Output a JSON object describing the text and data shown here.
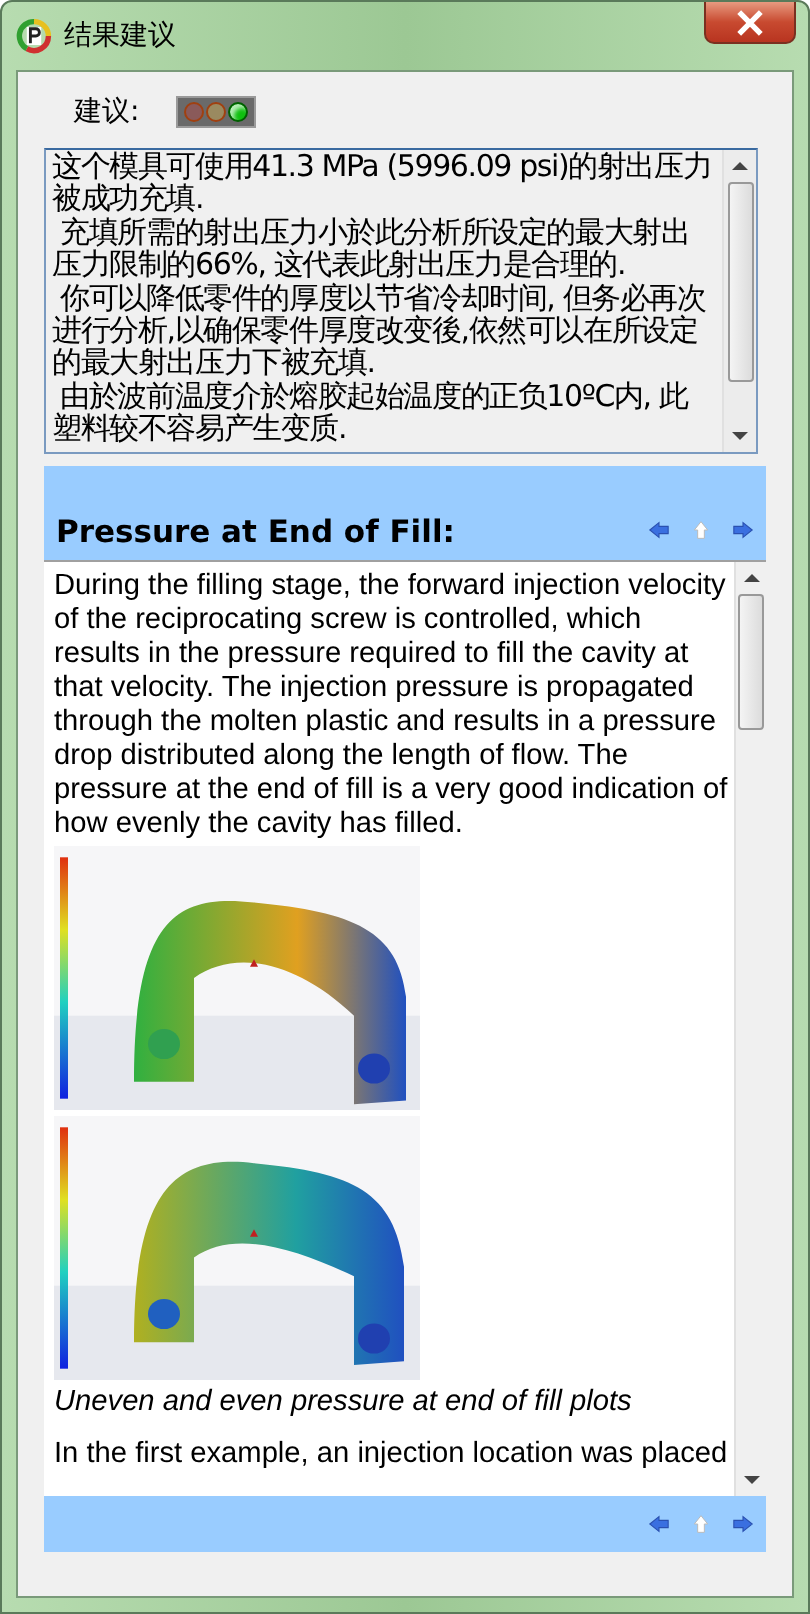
{
  "window": {
    "title": "结果建议"
  },
  "advice": {
    "label": "建议:",
    "lights": [
      {
        "color": "#8a5a5a",
        "on": false
      },
      {
        "color": "#9a8a60",
        "on": false
      },
      {
        "color": "#10c010",
        "on": true
      }
    ]
  },
  "summary": {
    "paragraphs": [
      "这个模具可使用41.3 MPa (5996.09 psi)的射出压力被成功充填.",
      " 充填所需的射出压力小於此分析所设定的最大射出压力限制的66%, 这代表此射出压力是合理的.",
      " 你可以降低零件的厚度以节省冷却时间, 但务必再次进行分析,以确保零件厚度改变後,依然可以在所设定的最大射出压力下被充填.",
      " 由於波前温度介於熔胶起始温度的正负10ºC内, 此塑料较不容易产生变质."
    ]
  },
  "help": {
    "title": "Pressure at End of Fill:",
    "content": [
      {
        "kind": "text",
        "text": "During the filling stage, the forward injection velocity of the reciprocating screw is controlled, which results in the pressure required to fill the cavity at that velocity. The injection pressure is propagated through the molten plastic and results in a pressure drop distributed along the length of flow. The pressure at the end of fill is a very good indication of how evenly the cavity has filled."
      },
      {
        "kind": "picture"
      },
      {
        "kind": "picture"
      },
      {
        "kind": "caption",
        "text": "Uneven and even pressure at end of fill plots"
      },
      {
        "kind": "text",
        "text": "In the first example, an injection location was placed"
      }
    ]
  }
}
